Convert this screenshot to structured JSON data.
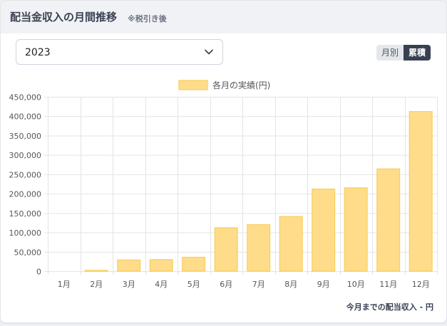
{
  "header": {
    "title": "配当金収入の月間推移",
    "subtitle": "※税引き後"
  },
  "controls": {
    "year_value": "2023",
    "toggle_monthly": "月別",
    "toggle_cumulative": "累積",
    "active_toggle": "累積"
  },
  "footer": {
    "label": "今月までの配当収入",
    "value": "- 円"
  },
  "colors": {
    "bar_fill": "#fedc8a",
    "bar_stroke": "#f8cf5a",
    "grid": "#e4e4e4"
  },
  "chart_data": {
    "type": "bar",
    "categories": [
      "1月",
      "2月",
      "3月",
      "4月",
      "5月",
      "6月",
      "7月",
      "8月",
      "9月",
      "10月",
      "11月",
      "12月"
    ],
    "series": [
      {
        "name": "各月の実績(円)",
        "values": [
          0,
          2000,
          29000,
          30000,
          36000,
          112000,
          120000,
          141000,
          212000,
          215000,
          264000,
          412000
        ]
      }
    ],
    "ylim": [
      0,
      450000
    ],
    "yticks": [
      0,
      50000,
      100000,
      150000,
      200000,
      250000,
      300000,
      350000,
      400000,
      450000
    ],
    "ytick_labels": [
      "0",
      "50,000",
      "100,000",
      "150,000",
      "200,000",
      "250,000",
      "300,000",
      "350,000",
      "400,000",
      "450,000"
    ],
    "legend_position": "top-center",
    "grid": true
  }
}
